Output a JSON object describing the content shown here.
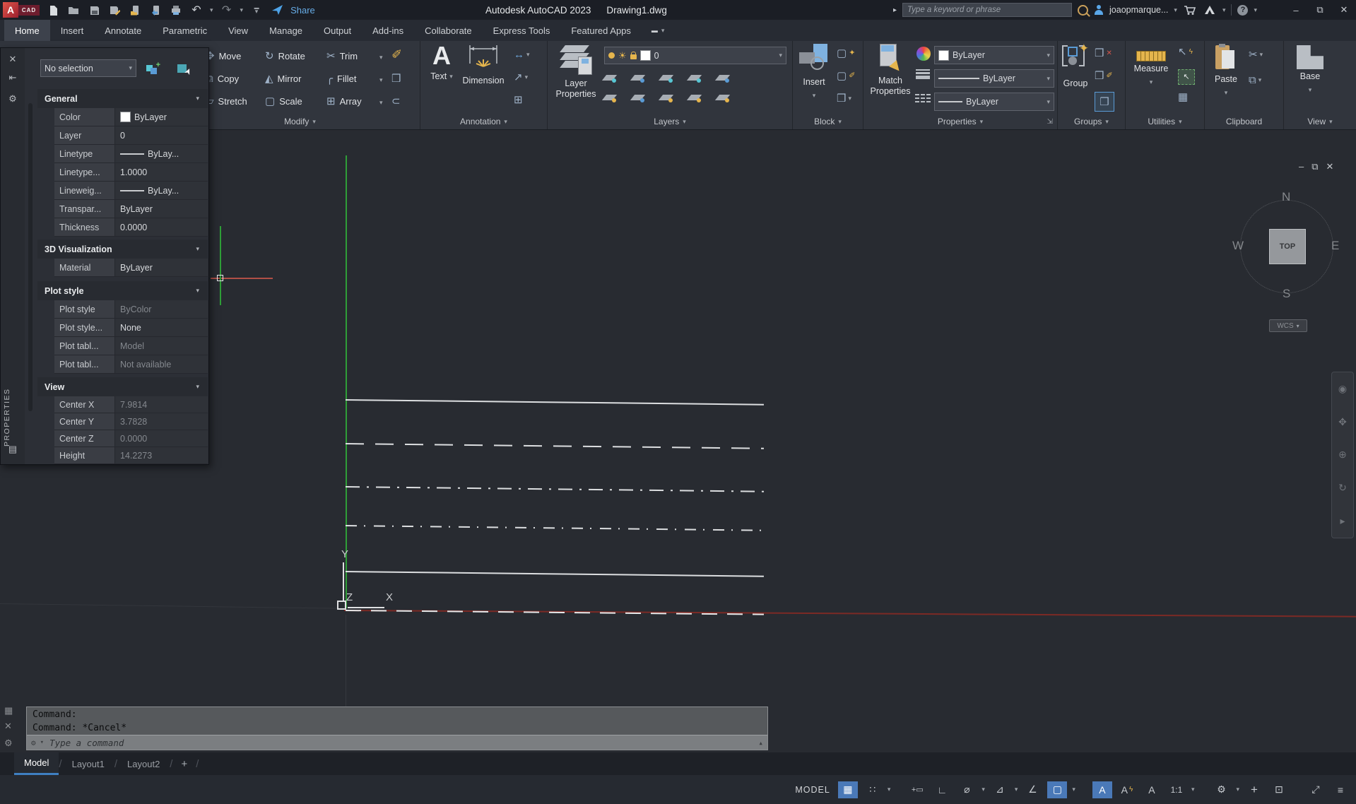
{
  "title_bar": {
    "app_title": "Autodesk AutoCAD 2023",
    "doc_title": "Drawing1.dwg",
    "share_label": "Share",
    "search_placeholder": "Type a keyword or phrase",
    "user_name": "joaopmarque...",
    "help_glyph": "?"
  },
  "ribbon": {
    "tabs": [
      "Home",
      "Insert",
      "Annotate",
      "Parametric",
      "View",
      "Manage",
      "Output",
      "Add-ins",
      "Collaborate",
      "Express Tools",
      "Featured Apps"
    ],
    "active_tab": "Home",
    "panel_labels": [
      "Modify",
      "Annotation",
      "Layers",
      "Block",
      "Properties",
      "Groups",
      "Utilities",
      "Clipboard",
      "View"
    ],
    "modify_tools": [
      "Move",
      "Rotate",
      "Trim",
      "Copy",
      "Mirror",
      "Fillet",
      "Stretch",
      "Scale",
      "Array"
    ],
    "annotation": {
      "text_label": "Text",
      "dimension_label": "Dimension"
    },
    "layers": {
      "big_label_1": "Layer",
      "big_label_2": "Properties",
      "layer_value": "0"
    },
    "block": {
      "insert_label": "Insert"
    },
    "properties": {
      "match_label_1": "Match",
      "match_label_2": "Properties",
      "color_value": "ByLayer",
      "lineweight_value": "ByLayer",
      "linetype_value": "ByLayer"
    },
    "groups": {
      "group_label": "Group"
    },
    "utilities": {
      "measure_label": "Measure"
    },
    "clipboard": {
      "paste_label": "Paste"
    },
    "view": {
      "base_label": "Base"
    }
  },
  "palette": {
    "side_label": "PROPERTIES",
    "selection": "No selection",
    "sections": [
      {
        "title": "General",
        "rows": [
          {
            "label": "Color",
            "value": "ByLayer"
          },
          {
            "label": "Layer",
            "value": "0"
          },
          {
            "label": "Linetype",
            "value": "ByLay..."
          },
          {
            "label": "Linetype...",
            "value": "1.0000"
          },
          {
            "label": "Lineweig...",
            "value": "ByLay..."
          },
          {
            "label": "Transpar...",
            "value": "ByLayer"
          },
          {
            "label": "Thickness",
            "value": "0.0000"
          }
        ]
      },
      {
        "title": "3D Visualization",
        "rows": [
          {
            "label": "Material",
            "value": "ByLayer"
          }
        ]
      },
      {
        "title": "Plot style",
        "rows": [
          {
            "label": "Plot style",
            "value": "ByColor"
          },
          {
            "label": "Plot style...",
            "value": "None"
          },
          {
            "label": "Plot tabl...",
            "value": "Model"
          },
          {
            "label": "Plot tabl...",
            "value": "Not available"
          }
        ]
      },
      {
        "title": "View",
        "rows": [
          {
            "label": "Center X",
            "value": "7.9814"
          },
          {
            "label": "Center Y",
            "value": "3.7828"
          },
          {
            "label": "Center Z",
            "value": "0.0000"
          },
          {
            "label": "Height",
            "value": "14.2273"
          }
        ]
      }
    ]
  },
  "canvas": {
    "viewcube": {
      "n": "N",
      "w": "W",
      "e": "E",
      "s": "S",
      "top": "TOP",
      "wcs": "WCS"
    },
    "ucs": {
      "x": "X",
      "y": "Y",
      "z": "Z"
    }
  },
  "command_line": {
    "history": [
      "Command:",
      "Command: *Cancel*"
    ],
    "placeholder": "Type a command"
  },
  "layout_tabs": {
    "tabs": [
      "Model",
      "Layout1",
      "Layout2"
    ],
    "active": "Model"
  },
  "status_bar": {
    "model_label": "MODEL",
    "scale": "1:1"
  },
  "icons": {
    "dropdown": "▾",
    "up": "▴",
    "close": "✕",
    "minimize": "–",
    "restore": "⧉",
    "arrow-right": "▸",
    "pin": "⇤",
    "gear": "⚙",
    "list": "▤",
    "menu": "≡",
    "plus": "+",
    "undo": "↶",
    "redo": "↷",
    "qat-bar": "▬",
    "move": "✥",
    "rotate": "↻",
    "trim": "✂",
    "erase": "✐",
    "copy": "⧉",
    "mirror": "◭",
    "fillet": "╭",
    "explode": "❒",
    "stretch": "▱",
    "scale": "▢",
    "array": "⊞",
    "offset": "⊂",
    "dim-linear": "↔",
    "leader": "↗",
    "table": "⊞",
    "sun": "☀",
    "cursor": "➤",
    "lightning": "ϟ",
    "star": "✦",
    "cut": "✂",
    "copy-doc": "⧉",
    "grid": "▦",
    "snap": "∷",
    "dyninput": "+▭",
    "ortho": "∟",
    "polar": "⌀",
    "iso": "⊿",
    "otrack": "∠",
    "osnap": "▢",
    "annot": "A",
    "isolate": "⊡",
    "expand": "⤢",
    "nav-wheel": "◉",
    "nav-pan": "✥",
    "nav-zoom": "⊕",
    "nav-orbit": "↻",
    "nav-more": "▸",
    "cmd-dots": "▦",
    "calc": "▦",
    "qselect": "↖"
  }
}
